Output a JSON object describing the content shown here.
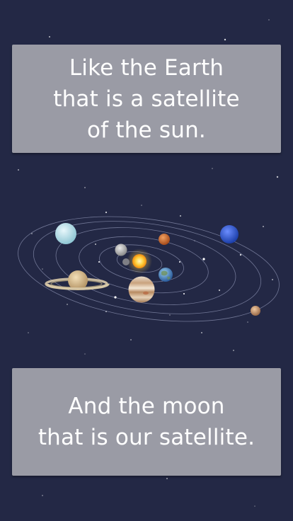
{
  "captions": {
    "top": {
      "line1": "Like the Earth",
      "line2": "that is a satellite",
      "line3": "of the sun."
    },
    "bottom": {
      "line1": "And the moon",
      "line2": "that is our satellite."
    }
  },
  "colors": {
    "background": "#232845",
    "card": "#9a9ba5",
    "text": "#ffffff",
    "orbit": "#8a90b0"
  },
  "solar_system": {
    "bodies": [
      "sun",
      "mercury",
      "venus",
      "earth",
      "mars",
      "jupiter",
      "saturn",
      "uranus",
      "neptune",
      "pluto"
    ]
  }
}
